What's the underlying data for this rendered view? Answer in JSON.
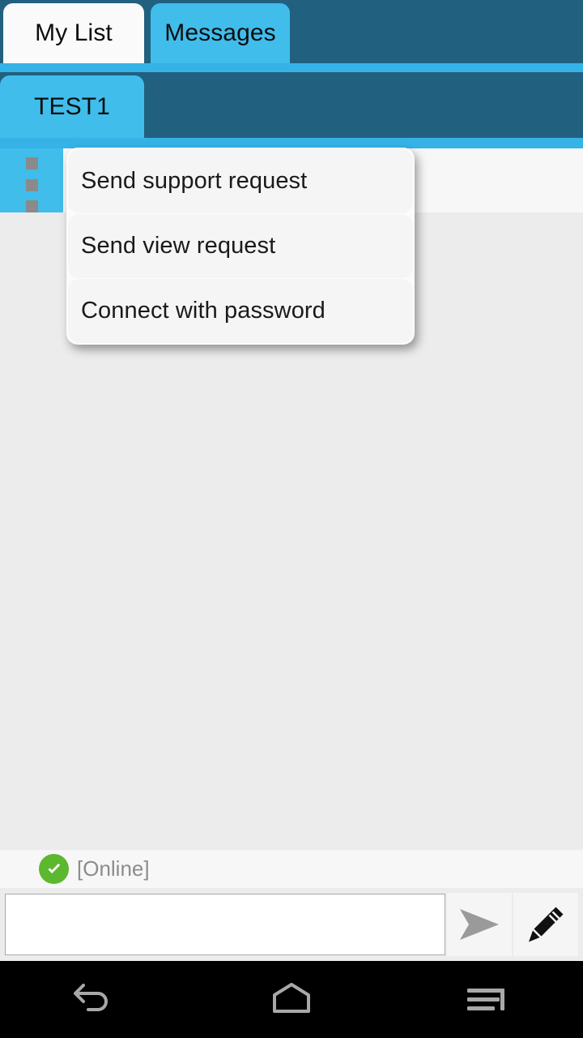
{
  "tabs": {
    "primary": [
      {
        "label": "My List",
        "selected": false
      },
      {
        "label": "Messages",
        "selected": true
      }
    ],
    "session": [
      {
        "label": "TEST1",
        "selected": true
      }
    ]
  },
  "toolbar": {
    "overflow_icon": "three-dots-vertical-icon",
    "close_icon": "close-x-icon"
  },
  "menu": {
    "items": [
      {
        "label": "Send support request"
      },
      {
        "label": "Send view request"
      },
      {
        "label": "Connect with password"
      }
    ]
  },
  "status": {
    "icon": "check-circle-icon",
    "text": "[Online]",
    "icon_color": "#5cb82e"
  },
  "composer": {
    "input_value": "",
    "input_placeholder": "",
    "send_icon": "paper-plane-icon",
    "edit_icon": "pencil-icon"
  },
  "navbar": {
    "back_icon": "back-arrow-icon",
    "home_icon": "home-icon",
    "recents_icon": "recents-icon"
  },
  "colors": {
    "header_dark": "#21607f",
    "accent_blue": "#35b3e7",
    "tab_blue": "#40bdeb",
    "canvas": "#ececec",
    "panel": "#f7f7f7"
  }
}
